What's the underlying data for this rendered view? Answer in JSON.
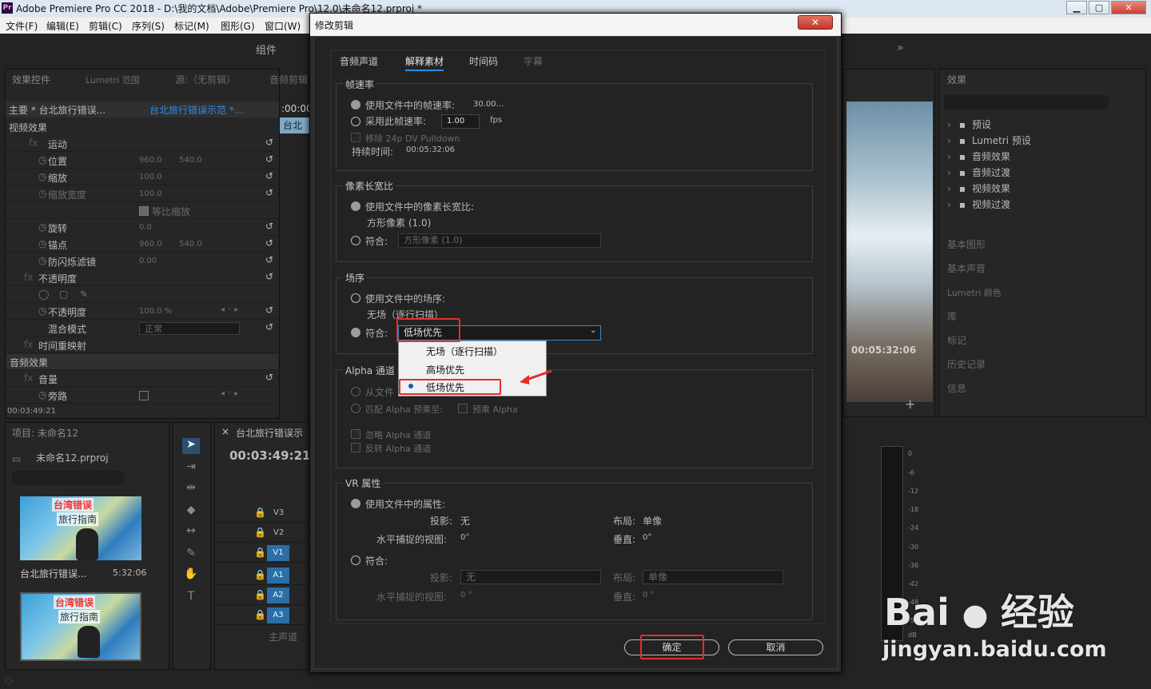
{
  "window": {
    "title": "Adobe Premiere Pro CC 2018 - D:\\我的文档\\Adobe\\Premiere Pro\\12.0\\未命名12.prproj *",
    "minimize": "▁",
    "maximize": "▢",
    "close": "✕"
  },
  "menu": [
    "文件(F)",
    "编辑(E)",
    "剪辑(C)",
    "序列(S)",
    "标记(M)",
    "图形(G)",
    "窗口(W)"
  ],
  "workspace": {
    "label": "组件",
    "more": "»"
  },
  "effect_controls": {
    "tabs": [
      "效果控件",
      "Lumetri 范围",
      "源:（无剪辑）",
      "音频剪辑"
    ],
    "master": "主要 * 台北旅行错误...",
    "sequence": "台北旅行错误示范 *...",
    "timecode_ruler": ":00:00",
    "clip_label": "台北",
    "video_effects": "视频效果",
    "rows": [
      {
        "name": "运动",
        "v1": "",
        "v2": ""
      },
      {
        "name": "位置",
        "v1": "960.0",
        "v2": "540.0"
      },
      {
        "name": "缩放",
        "v1": "100.0",
        "v2": ""
      },
      {
        "name": "缩放宽度",
        "v1": "100.0",
        "v2": ""
      },
      {
        "name": "等比缩放",
        "v1": "",
        "v2": ""
      },
      {
        "name": "旋转",
        "v1": "0.0",
        "v2": ""
      },
      {
        "name": "锚点",
        "v1": "960.0",
        "v2": "540.0"
      },
      {
        "name": "防闪烁滤镜",
        "v1": "0.00",
        "v2": ""
      },
      {
        "name": "不透明度",
        "v1": "",
        "v2": ""
      },
      {
        "name": "",
        "v1": "",
        "v2": ""
      },
      {
        "name": "不透明度",
        "v1": "100.0 %",
        "v2": ""
      },
      {
        "name": "混合模式",
        "v1": "正常",
        "v2": ""
      },
      {
        "name": "时间重映射",
        "v1": "",
        "v2": ""
      }
    ],
    "audio_effects": "音频效果",
    "audio_rows": [
      {
        "name": "音量"
      },
      {
        "name": "旁路"
      }
    ],
    "time": "00:03:49:21"
  },
  "project": {
    "title": "项目: 未命名12",
    "file": "未命名12.prproj",
    "clip1": {
      "cap": "台湾错误",
      "cap2": "旅行指南",
      "name": "台北旅行错误...",
      "duration": "5:32:06"
    },
    "clip2": {
      "cap": "台湾错误",
      "cap2": "旅行指南"
    }
  },
  "timeline": {
    "title": "台北旅行错误示",
    "timecode": "00:03:49:21",
    "tracks": [
      "V3",
      "V2",
      "V1",
      "A1",
      "A2",
      "A3"
    ],
    "master": "主声道"
  },
  "program": {
    "timecode": "00:05:32:06"
  },
  "effects_panel": {
    "title": "效果",
    "items": [
      "预设",
      "Lumetri 预设",
      "音频效果",
      "音频过渡",
      "视频效果",
      "视频过渡"
    ],
    "panels": [
      "基本图形",
      "基本声音",
      "Lumetri 颜色",
      "库",
      "标记",
      "历史记录",
      "信息"
    ]
  },
  "meter": {
    "ticks": [
      "0",
      "-6",
      "-12",
      "-18",
      "-24",
      "-30",
      "-36",
      "-42",
      "-48",
      "-54",
      "dB"
    ]
  },
  "dialog": {
    "title": "修改剪辑",
    "close": "✕",
    "tabs": [
      "音频声道",
      "解释素材",
      "时间码",
      "字幕"
    ],
    "frame_rate": {
      "title": "帧速率",
      "use_file": "使用文件中的帧速率:",
      "file_value": "30.00...",
      "assume": "采用此帧速率:",
      "assume_value": "1.00",
      "fps": "fps",
      "pulldown": "移除 24p DV Pulldown",
      "duration_label": "持续时间:",
      "duration": "00:05:32:06"
    },
    "pixel": {
      "title": "像素长宽比",
      "use_file": "使用文件中的像素长宽比:",
      "file_value": "方形像素 (1.0)",
      "conform": "符合:",
      "conform_value": "方形像素 (1.0)"
    },
    "field": {
      "title": "场序",
      "use_file": "使用文件中的场序:",
      "file_value": "无场（逐行扫描）",
      "conform": "符合:",
      "conform_value": "低场优先",
      "options": [
        "无场（逐行扫描）",
        "高场优先",
        "低场优先"
      ]
    },
    "alpha": {
      "title": "Alpha 通道",
      "from_file": "从文件",
      "match": "匹配 Alpha 预乘至:",
      "premult": "预乘 Alpha",
      "ignore": "忽略 Alpha 通道",
      "invert": "反转 Alpha 通道"
    },
    "vr": {
      "title": "VR 属性",
      "use_file": "使用文件中的属性:",
      "projection_label": "投影:",
      "projection": "无",
      "layout_label": "布局:",
      "layout": "单像",
      "hfov_label": "水平捕捉的视图:",
      "hfov": "0°",
      "vfov_label": "垂直:",
      "vfov": "0°",
      "conform": "符合:",
      "c_projection": "无",
      "c_layout": "单像",
      "c_hfov": "0 °",
      "c_vfov": "0 °"
    },
    "ok": "确定",
    "cancel": "取消"
  },
  "watermark": {
    "brand": "Bai",
    "brand2": "经验",
    "url": "jingyan.baidu.com"
  }
}
